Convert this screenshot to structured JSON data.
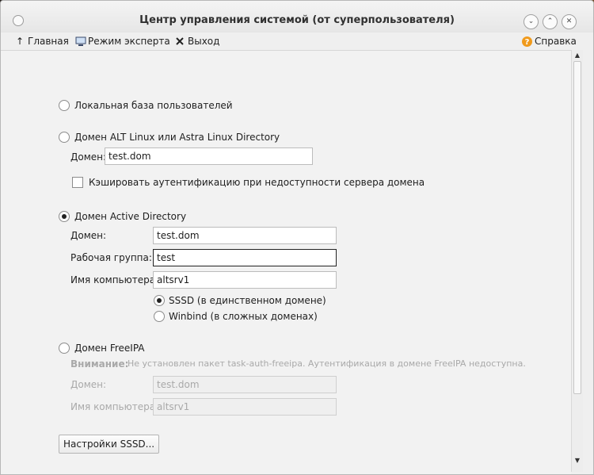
{
  "window": {
    "title": "Центр управления системой (от суперпользователя)"
  },
  "toolbar": {
    "home_label": "Главная",
    "expert_label": "Режим эксперта",
    "exit_label": "Выход",
    "help_label": "Справка"
  },
  "auth": {
    "local": {
      "label": "Локальная база пользователей",
      "selected": false
    },
    "alt": {
      "label": "Домен ALT Linux или Astra Linux Directory",
      "selected": false,
      "domain_label": "Домен:",
      "domain_value": "test.dom",
      "cache_label": "Кэшировать аутентификацию при недоступности сервера домена",
      "cache_checked": false
    },
    "ad": {
      "label": "Домен Active Directory",
      "selected": true,
      "domain_label": "Домен:",
      "domain_value": "test.dom",
      "workgroup_label": "Рабочая группа:",
      "workgroup_value": "test",
      "computer_label": "Имя компьютера:",
      "computer_value": "altsrv1",
      "sssd_label": "SSSD (в единственном домене)",
      "winbind_label": "Winbind (в сложных доменах)",
      "selected_backend": "SSSD"
    },
    "freeipa": {
      "label": "Домен FreeIPA",
      "selected": false,
      "warning_title": "Внимание:",
      "warning_text": "Не установлен пакет task-auth-freeipa. Аутентификация в домене FreeIPA недоступна.",
      "domain_label": "Домен:",
      "domain_value": "test.dom",
      "computer_label": "Имя компьютера:",
      "computer_value": "altsrv1"
    },
    "sssd_settings_label": "Настройки SSSD..."
  },
  "colors": {
    "help_icon": "#f09a1c",
    "window_bg": "#efefef",
    "desktop": "#2a2420"
  }
}
